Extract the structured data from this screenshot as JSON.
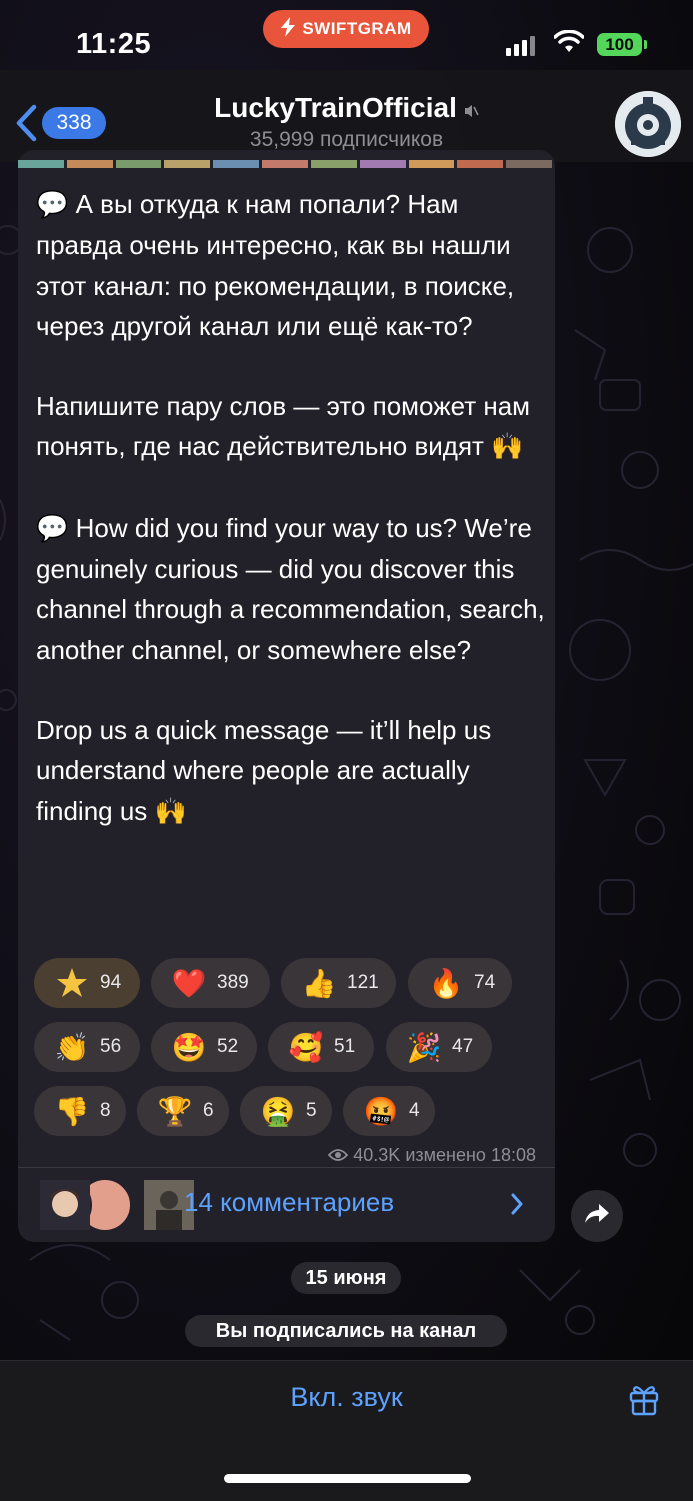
{
  "status_bar": {
    "time": "11:25",
    "app_badge": "SWIFTGRAM",
    "battery": "100"
  },
  "header": {
    "back_count": "338",
    "channel_name": "LuckyTrainOfficial",
    "subscribers": "35,999 подписчиков"
  },
  "message": {
    "paragraphs": [
      "А вы откуда к нам попали? Нам правда очень интересно, как вы нашли этот канал: по рекомендации, в поиске, через другой канал или ещё как-то?",
      "Напишите пару слов — это поможет нам понять, где нас действительно видят",
      "How did you find your way to us? We’re genuinely curious — did you discover this channel through a recommendation, search, another channel, or somewhere else?",
      "Drop us a quick message — it’ll help us understand where people are actually finding us"
    ],
    "reactions": [
      {
        "icon": "star-sparkle",
        "count": "94"
      },
      {
        "icon": "red-heart",
        "count": "389"
      },
      {
        "icon": "thumbs-up",
        "count": "121"
      },
      {
        "icon": "fire",
        "count": "74"
      },
      {
        "icon": "clapping-hands",
        "count": "56"
      },
      {
        "icon": "star-struck-face",
        "count": "52"
      },
      {
        "icon": "smiling-face-with-hearts",
        "count": "51"
      },
      {
        "icon": "party-popper",
        "count": "47"
      },
      {
        "icon": "thumbs-down",
        "count": "8"
      },
      {
        "icon": "trophy",
        "count": "6"
      },
      {
        "icon": "vomiting-face",
        "count": "5"
      },
      {
        "icon": "cursing-face",
        "count": "4"
      }
    ],
    "views": "40.3K",
    "edited_label": "изменено",
    "edit_time": "18:08",
    "comments_label": "14 комментариев"
  },
  "service": {
    "date": "15 июня",
    "subscribed": "Вы подписались на канал"
  },
  "bottom_bar": {
    "unmute_label": "Вкл. звук"
  },
  "colors": {
    "accent": "#5ea2ff",
    "badge": "#3a79e6",
    "swiftgram": "#e8553a",
    "battery": "#54d65a",
    "bubble": "#222029"
  }
}
